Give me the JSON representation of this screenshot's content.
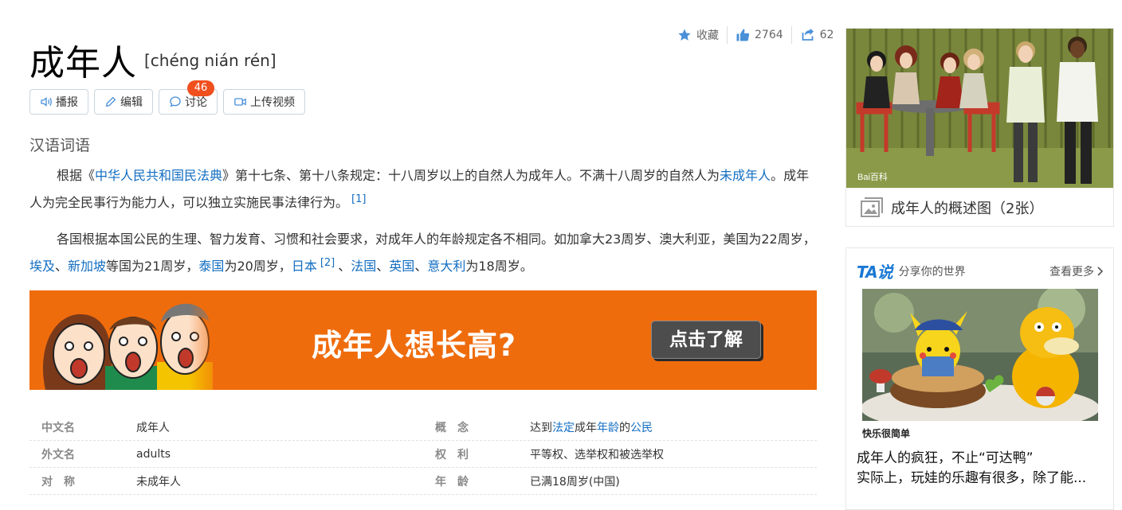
{
  "stats": {
    "favorite_label": "收藏",
    "like_count": "2764",
    "share_count": "62"
  },
  "header": {
    "title": "成年人",
    "pinyin": "[chéng nián rén]"
  },
  "toolbar": {
    "play_label": "播报",
    "edit_label": "编辑",
    "discuss_label": "讨论",
    "discuss_badge": "46",
    "upload_label": "上传视频"
  },
  "category": "汉语词语",
  "para1": {
    "t1": "根据《",
    "l1": "中华人民共和国民法典",
    "t2": "》第十七条、第十八条规定：十八周岁以上的自然人为成年人。不满十八周岁的自然人为",
    "l2": "未成年人",
    "t3": "。成年人为完全民事行为能力人，可以独立实施民事法律行为。",
    "ref": "[1]"
  },
  "para2": {
    "t1": "各国根据本国公民的生理、智力发育、习惯和社会要求，对成年人的年龄规定各不相同。如加拿大23周岁、澳大利亚，美国为22周岁，",
    "l1": "埃及",
    "s1": "、",
    "l2": "新加坡",
    "t2": "等国为21周岁，",
    "l3": "泰国",
    "t3": "为20周岁，",
    "l4": "日本",
    "ref": "[2]",
    "s2": "、",
    "l5": "法国",
    "s3": "、",
    "l6": "英国",
    "s4": "、",
    "l7": "意大利",
    "t4": "为18周岁。"
  },
  "banner": {
    "headline": "成年人想长高?",
    "cta": "点击了解"
  },
  "info": {
    "r1": {
      "k1": "中文名",
      "v1": "成年人",
      "k2": "概　念",
      "v2a": "达到",
      "v2l1": "法定",
      "v2b": "成年",
      "v2l2": "年龄",
      "v2c": "的",
      "v2l3": "公民"
    },
    "r2": {
      "k1": "外文名",
      "v1": "adults",
      "k2": "权　利",
      "v2": "平等权、选举权和被选举权"
    },
    "r3": {
      "k1": "对　称",
      "v1": "未成年人",
      "k2": "年　龄",
      "v2": "已满18周岁(中国)"
    }
  },
  "sidebar": {
    "pic_caption": "成年人的概述图（2张）",
    "pic_watermark": "Bai百科",
    "ta_logo": "TA说",
    "ta_slogan": "分享你的世界",
    "ta_more": "查看更多",
    "ta_author": "快乐很简单",
    "ta_title": "成年人的疯狂，不止“可达鸭”",
    "ta_desc": "实际上，玩娃的乐趣有很多，除了能..."
  }
}
